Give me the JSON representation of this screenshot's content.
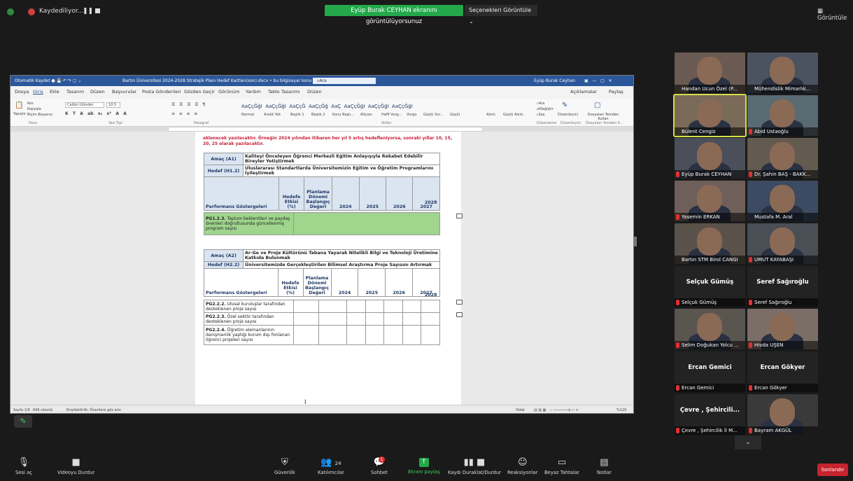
{
  "topbar": {
    "recording_label": "Kaydediliyor...",
    "pause_label": "❚❚",
    "share_banner": "Eyüp Burak CEYHAN ekranını görüntülüyorsunuz",
    "view_options": "Seçenekleri Görüntüle  ⌄",
    "view_button": "Görüntüle"
  },
  "word": {
    "title_left": "Otomatik Kaydet  ●  💾 ↶ ↷ ▢ ⌄",
    "title_center": "Bartın Üniversitesi 2024-2028 Stratejik Planı Hedef Kartları(son).docx • bu bilgisayar konumuna kaydedildi ⌄",
    "search": "Ara",
    "title_user": "Eyüp Burak Ceyhan",
    "tabs": [
      "Dosya",
      "Giriş",
      "Ekle",
      "Tasarım",
      "Düzen",
      "Başvurular",
      "Posta Gönderileri",
      "Gözden Geçir",
      "Görünüm",
      "Yardım",
      "Tablo Tasarımı",
      "Düzen"
    ],
    "tab_right1": "Açıklamalar",
    "tab_right2": "Paylaş",
    "ribbon": {
      "paste": "Yapıştır",
      "cut": "Kes",
      "copy": "Kopyala",
      "format_painter": "Biçim Boyacısı",
      "font": "Calibri (Gövde)",
      "size": "10,5",
      "styles": [
        "Normal",
        "Aralık Yok",
        "Başlık 1",
        "Başlık 2",
        "Konu Başlı...",
        "Altyazı",
        "Hafif Vurg...",
        "Vurgu",
        "Güçlü Vur...",
        "Güçlü",
        "Alıntı",
        "Güçlü Alıntı"
      ],
      "find": "Ara",
      "replace": "Değiştir",
      "select": "Seç",
      "editor": "Düzenleyici",
      "reuse": "Dosyaları Yeniden Kullan",
      "groups": [
        "Pano",
        "Yazı Tipi",
        "Paragraf",
        "Stiller",
        "Düzenleme",
        "Düzenleyici",
        "Dosyaları Yeniden K..."
      ]
    },
    "intro_text": "eklenecek yazılacaktır. Örneğin 2024 yılından itibaren her yıl 5 artış hedefleniyorsa, sonraki yıllar 10, 15, 20, 25 olarak yazılacaktır.",
    "table1": {
      "amac_label": "Amaç (A1)",
      "amac_text": "Kaliteyi Önceleyen Öğrenci Merkezli Eğitim Anlayışıyla Rekabet Edebilir Bireyler Yetiştirmek",
      "hedef_label": "Hedef (H1.2)",
      "hedef_text": "Uluslararası Standartlarda Üniversitemizin Eğitim ve Öğretim Programlarını İyileştirmek",
      "perf_label": "Performans Göstergeleri",
      "col_effect": "Hedefe Etkisi (%)",
      "col_base": "Planlama Dönemi Başlangıç Değeri",
      "years": [
        "2024",
        "2025",
        "2026",
        "2027",
        "2028"
      ],
      "rows": [
        {
          "code": "PG1.2.3.",
          "text": "Toplum beklentileri ve paydaş önerileri doğrultusunda güncellenmiş program sayısı"
        }
      ]
    },
    "table2": {
      "amac_label": "Amaç (A2)",
      "amac_text": "Ar-Ge ve Proje Kültürünü Tabana Yayarak Nitelikli Bilgi ve Teknoloji Üretimine Katkıda Bulunmak",
      "hedef_label": "Hedef (H2.2)",
      "hedef_text": "Üniversitemizde Gerçekleştirilen Bilimsel Araştırma Proje Sayısını Artırmak",
      "perf_label": "Performans Göstergeleri",
      "col_effect": "Hedefe Etkisi (%)",
      "col_base": "Planlama Dönemi Başlangıç Değeri",
      "years": [
        "2024",
        "2025",
        "2026",
        "2027",
        "2028"
      ],
      "rows": [
        {
          "code": "PG2.2.2.",
          "text": "Ulusal kuruluşlar tarafından desteklenen proje sayısı"
        },
        {
          "code": "PG2.2.3.",
          "text": "Özel sektör tarafından desteklenen proje sayısı"
        },
        {
          "code": "PG2.2.4.",
          "text": "Öğretim elemanlarının danışmanlık yaptığı kurum dışı fonlanan öğrenci projeleri sayısı"
        }
      ]
    },
    "status": {
      "page": "Sayfa 1/9",
      "words": "646 sözcük",
      "accessibility": "Erişilebilirlik: Önerilere göz atın",
      "focus": "Odak",
      "zoom": "%120"
    }
  },
  "participants": [
    {
      "name": "Handan Ucun Özel (P...",
      "muted": false,
      "video": true
    },
    {
      "name": "Mühendislik Mimarlık...",
      "muted": false,
      "video": true
    },
    {
      "name": "Bülent Cengiz",
      "muted": false,
      "video": true,
      "active": true
    },
    {
      "name": "Abid Ustaoğlu",
      "muted": true,
      "video": true
    },
    {
      "name": "Eyüp Burak CEYHAN",
      "muted": true,
      "video": true
    },
    {
      "name": "Dr. Şahin BAŞ - BAKK...",
      "muted": true,
      "video": true
    },
    {
      "name": "Yasemin ERKAN",
      "muted": true,
      "video": true
    },
    {
      "name": "Mustafa M. Aral",
      "muted": false,
      "video": true
    },
    {
      "name": "Bartın STM Birol CANGI",
      "muted": false,
      "video": true
    },
    {
      "name": "UMUT KAYABAŞI",
      "muted": true,
      "video": true
    },
    {
      "name": "Selçuk Gümüş",
      "big": "Selçuk Gümüş",
      "muted": true,
      "video": false
    },
    {
      "name": "Seref Sağıroğlu",
      "big": "Seref Sağıroğlu",
      "muted": true,
      "video": false
    },
    {
      "name": "Selim Doğukan Yolcu ...",
      "muted": true,
      "video": true
    },
    {
      "name": "Hivda UŞEN",
      "muted": true,
      "video": true
    },
    {
      "name": "Ercan Gemici",
      "big": "Ercan Gemici",
      "muted": true,
      "video": false
    },
    {
      "name": "Ercan Gökyer",
      "big": "Ercan Gökyer",
      "muted": true,
      "video": false
    },
    {
      "name": "Çevre , Şehircilik İl M...",
      "big": "Çevre , Şehircili...",
      "muted": true,
      "video": false
    },
    {
      "name": "Bayram AKGÜL",
      "muted": true,
      "video": true
    }
  ],
  "toolbar": {
    "mute": "Sesi aç",
    "video": "Videoyu Durdur",
    "security": "Güvenlik",
    "participants": "Katılımcılar",
    "participants_count": "24",
    "chat": "Sohbet",
    "chat_badge": "1",
    "share": "Ekranı paylaş",
    "record": "Kaydı Duraklat/Durdur",
    "reactions": "Reaksiyonlar",
    "whiteboard": "Beyaz Tahtalar",
    "notes": "Notlar",
    "end": "Sonlandır"
  },
  "colors": {
    "share_green": "#23a94b",
    "word_blue": "#2b579a",
    "end_red": "#c7232f",
    "table_green": "#9fd58c",
    "intro_red": "#c8203a"
  }
}
